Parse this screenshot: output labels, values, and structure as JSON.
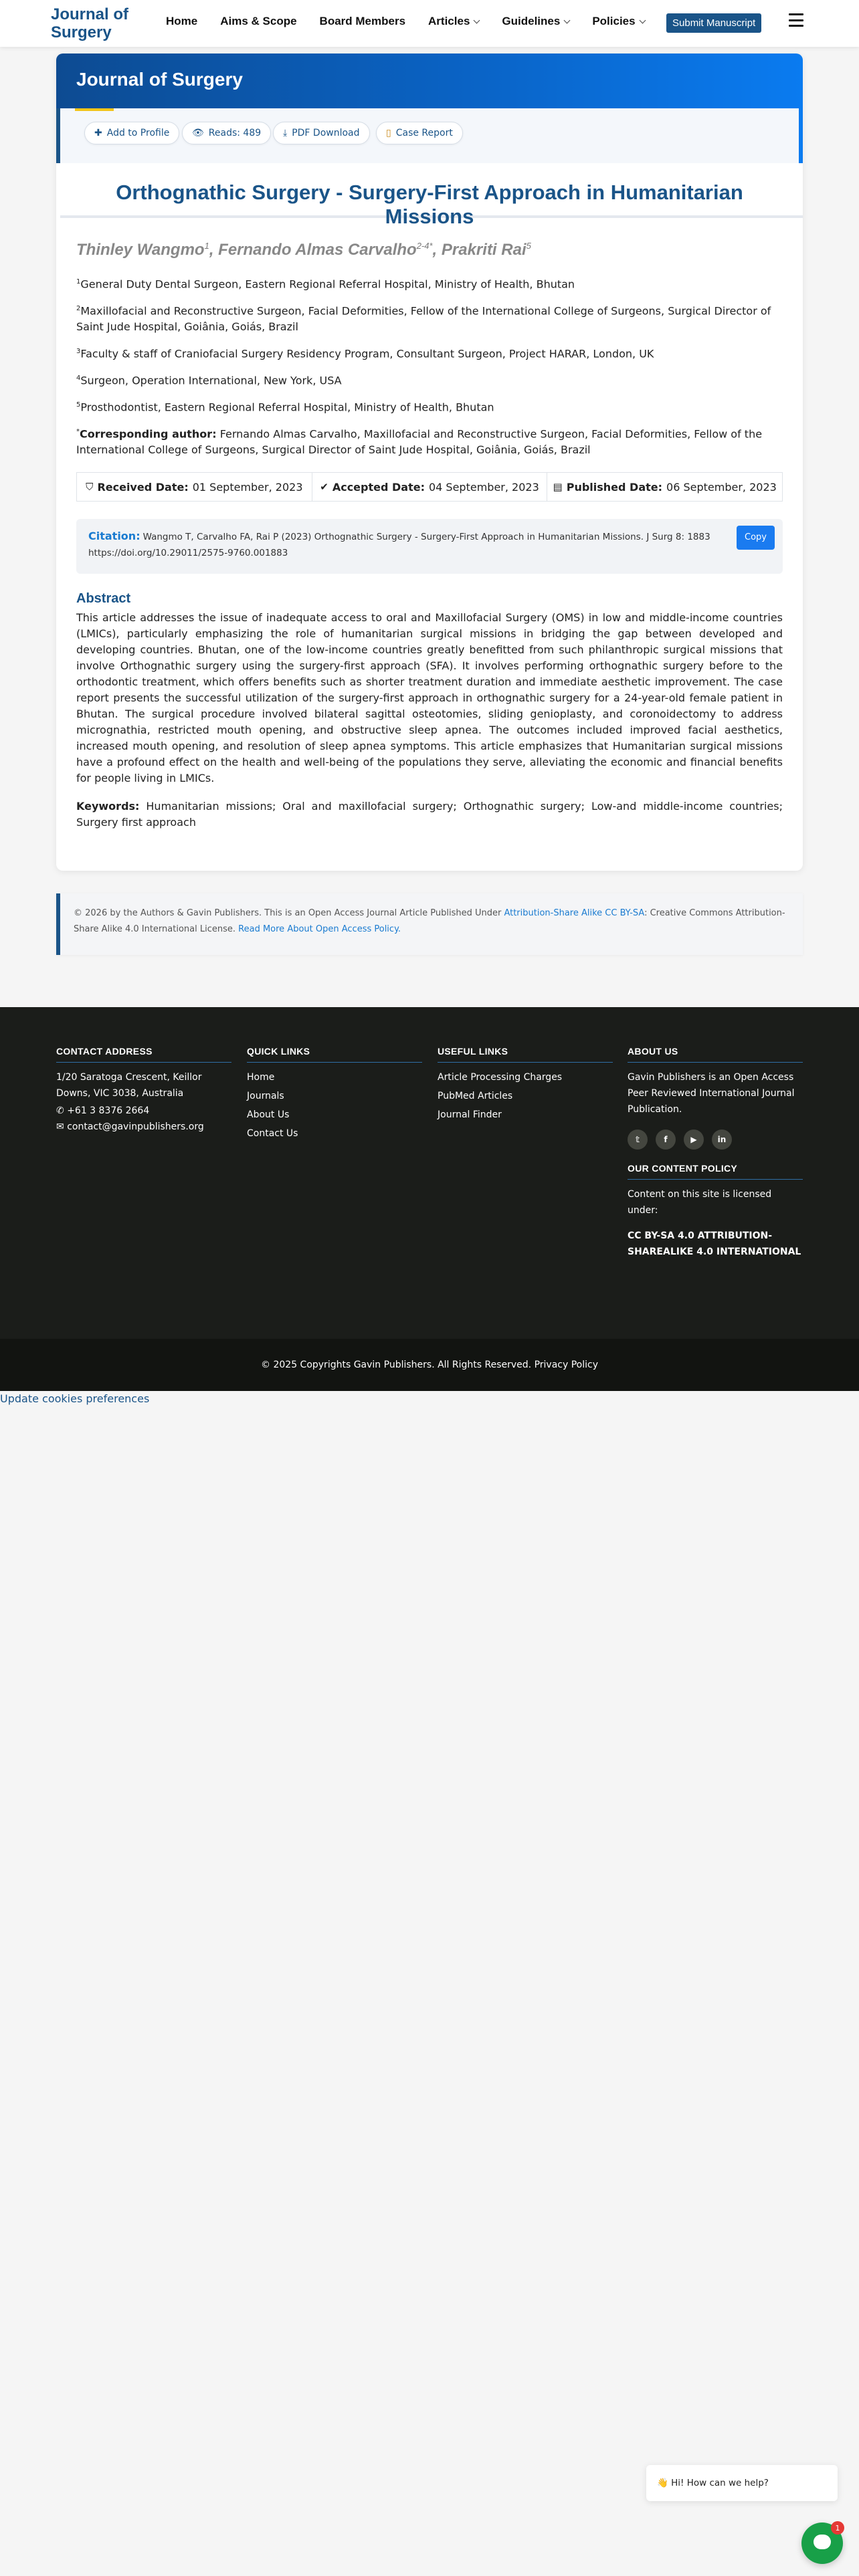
{
  "navbar": {
    "brand": "Journal of Surgery",
    "items": [
      {
        "label": "Home",
        "has_dropdown": false
      },
      {
        "label": "Aims & Scope",
        "has_dropdown": false
      },
      {
        "label": "Board Members",
        "has_dropdown": false
      },
      {
        "label": "Articles",
        "has_dropdown": true
      },
      {
        "label": "Guidelines",
        "has_dropdown": true
      },
      {
        "label": "Policies",
        "has_dropdown": true
      }
    ],
    "submit_label": "Submit Manuscript",
    "menu_icon": "hamburger-icon"
  },
  "journal_title": "Journal of Surgery",
  "actions": {
    "add_profile": "Add to Profile",
    "reads": "Reads: 489",
    "pdf": "PDF Download",
    "case_report": "Case Report"
  },
  "article": {
    "title": "Orthognathic Surgery - Surgery-First Approach in Humanitarian Missions",
    "authors": [
      {
        "name": "Thinley Wangmo",
        "sup": "1"
      },
      {
        "name": "Fernando Almas Carvalho",
        "sup": "2-4*"
      },
      {
        "name": "Prakriti Rai",
        "sup": "5"
      }
    ],
    "affiliations": [
      {
        "num": "1",
        "text": "General Duty Dental Surgeon, Eastern Regional Referral Hospital, Ministry of Health, Bhutan"
      },
      {
        "num": "2",
        "text": "Maxillofacial and Reconstructive Surgeon, Facial Deformities, Fellow of the International College of Surgeons, Surgical Director of Saint Jude Hospital, Goiânia, Goiás, Brazil"
      },
      {
        "num": "3",
        "text": "Faculty & staff of Craniofacial Surgery Residency Program, Consultant Surgeon, Project HARAR, London, UK"
      },
      {
        "num": "4",
        "text": "Surgeon, Operation International, New York, USA"
      },
      {
        "num": "5",
        "text": "Prosthodontist, Eastern Regional Referral Hospital, Ministry of Health, Bhutan"
      }
    ],
    "corresponding": {
      "label": "Corresponding author:",
      "text": "Fernando Almas Carvalho, Maxillofacial and Reconstructive Surgeon, Facial Deformities, Fellow of the International College of Surgeons, Surgical Director of Saint Jude Hospital, Goiânia, Goiás, Brazil"
    },
    "dates": {
      "received_label": "Received Date:",
      "received": "01 September, 2023",
      "accepted_label": "Accepted Date:",
      "accepted": "04 September, 2023",
      "published_label": "Published Date:",
      "published": "06 September, 2023"
    },
    "citation": {
      "label": "Citation:",
      "text": "Wangmo T, Carvalho FA, Rai P (2023) Orthognathic Surgery - Surgery-First Approach in Humanitarian Missions. J Surg 8: 1883",
      "doi": "https://doi.org/10.29011/2575-9760.001883",
      "copy_label": "Copy"
    },
    "abstract_heading": "Abstract",
    "abstract": "This article addresses the issue of inadequate access to oral and Maxillofacial Surgery (OMS) in low and middle-income countries (LMICs), particularly emphasizing the role of humanitarian surgical missions in bridging the gap between developed and developing countries. Bhutan, one of the low-income countries greatly benefitted from such philanthropic surgical missions that involve Orthognathic surgery using the surgery-first approach (SFA). It involves performing orthognathic surgery before to the orthodontic treatment, which offers benefits such as shorter treatment duration and immediate aesthetic improvement. The case report presents the successful utilization of the surgery-first approach in orthognathic surgery for a 24-year-old female patient in Bhutan. The surgical procedure involved bilateral sagittal osteotomies, sliding genioplasty, and coronoidectomy to address micrognathia, restricted mouth opening, and obstructive sleep apnea. The outcomes included improved facial aesthetics, increased mouth opening, and resolution of sleep apnea symptoms. This article emphasizes that Humanitarian surgical missions have a profound effect on the health and well-being of the populations they serve, alleviating the economic and financial benefits for people living in LMICs.",
    "keywords_label": "Keywords:",
    "keywords": "Humanitarian missions; Oral and maxillofacial surgery; Orthognathic surgery; Low-and middle-income countries; Surgery first approach"
  },
  "license": {
    "text1": "© 2026 by the Authors & Gavin Publishers. This is an Open Access Journal Article Published Under",
    "link1": "Attribution-Share Alike CC BY-SA",
    "text2": ": Creative Commons Attribution-Share Alike 4.0 International License.",
    "link2": "Read More About Open Access Policy."
  },
  "footer": {
    "contact": {
      "heading": "CONTACT ADDRESS",
      "address": "1/20 Saratoga Crescent, Keillor Downs, VIC 3038, Australia",
      "phone": "+61 3 8376 2664",
      "email": "contact@gavinpublishers.org"
    },
    "quick_links": {
      "heading": "QUICK LINKS",
      "items": [
        "Home",
        "Journals",
        "About Us",
        "Contact Us"
      ]
    },
    "useful_links": {
      "heading": "USEFUL LINKS",
      "items": [
        "Article Processing Charges",
        "PubMed Articles",
        "Journal Finder"
      ]
    },
    "about": {
      "heading": "ABOUT US",
      "text": "Gavin Publishers is an Open Access Peer Reviewed International Journal Publication.",
      "socials": [
        "twitter-icon",
        "facebook-icon",
        "youtube-icon",
        "linkedin-icon"
      ],
      "content_policy_heading": "OUR CONTENT POLICY",
      "content_policy_text": "Content on this site is licensed under:",
      "license_name": "CC BY-SA 4.0 ATTRIBUTION-SHAREALIKE 4.0 INTERNATIONAL"
    },
    "copyright": "© 2025 Copyrights Gavin Publishers. All Rights Reserved. Privacy Policy"
  },
  "cookie_link": "Update cookies preferences",
  "chat": {
    "greeting": "👋 Hi! How can we help?",
    "badge": "1"
  },
  "colors": {
    "brand": "#1a5488",
    "header_gradient_start": "#0d4b92",
    "header_gradient_end": "#0a7bf0",
    "accent_yellow": "#f5c518",
    "footer_bg": "#1b1d1a",
    "chat_green": "#18a048"
  }
}
